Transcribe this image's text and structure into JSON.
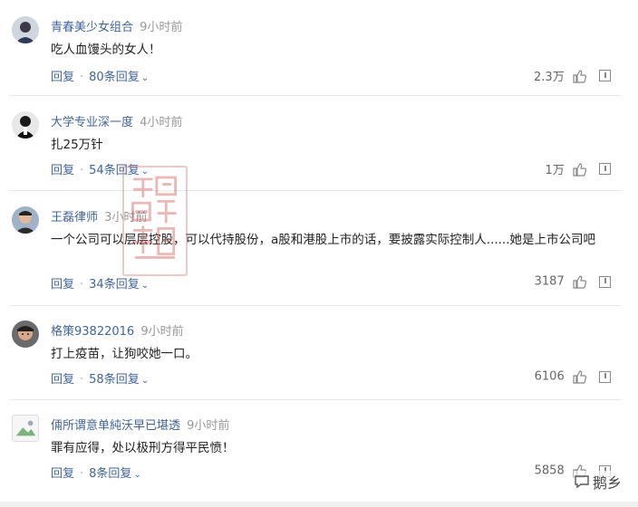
{
  "comments": [
    {
      "user": "青春美少女组合",
      "time": "9小时前",
      "text": "吃人血馒头的女人！",
      "reply_label": "回复",
      "replies": "80条回复",
      "likes": "2.3万"
    },
    {
      "user": "大学专业深一度",
      "time": "4小时前",
      "text": "扎25万针",
      "reply_label": "回复",
      "replies": "54条回复",
      "likes": "1万"
    },
    {
      "user": "王磊律师",
      "time": "3小时前",
      "text": "一个公司可以层层控股，可以代持股份，a股和港股上市的话，要披露实际控制人......她是上市公司吧",
      "reply_label": "回复",
      "replies": "34条回复",
      "likes": "3187"
    },
    {
      "user": "格策93822016",
      "time": "9小时前",
      "text": "打上疫苗，让狗咬她一口。",
      "reply_label": "回复",
      "replies": "58条回复",
      "likes": "6106"
    },
    {
      "user": "倆所谓意单純沃早已堪透",
      "time": "9小时前",
      "text": "罪有应得，处以极刑方得平民愤！",
      "reply_label": "回复",
      "replies": "8条回复",
      "likes": "5858"
    }
  ],
  "icons": {
    "like": "thumbs-up-icon",
    "report": "report-icon",
    "expand": "chevron-down-icon"
  },
  "watermark": {
    "text": "鹅乡"
  },
  "colors": {
    "username": "#406599",
    "time": "#999999",
    "divider": "#e8e8e8",
    "seal": "#d25a5a"
  }
}
